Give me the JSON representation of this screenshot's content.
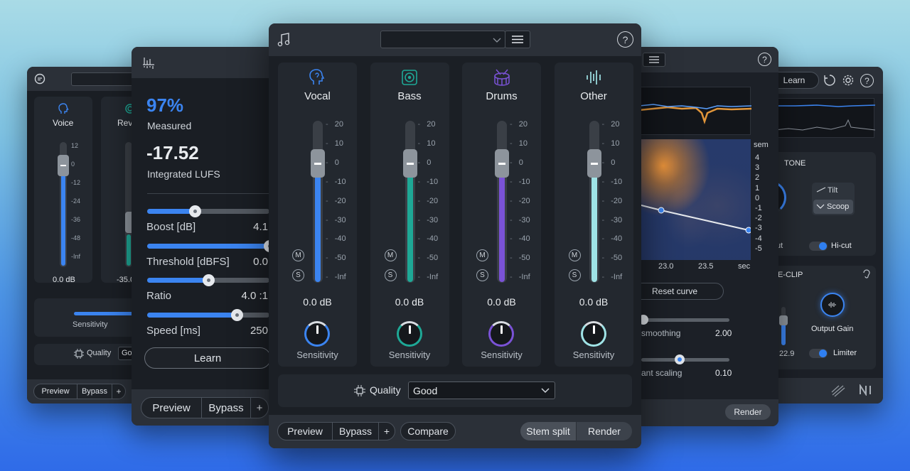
{
  "far_left": {
    "channels": [
      {
        "label": "Voice"
      },
      {
        "label": "Rev"
      }
    ],
    "scale": [
      "12",
      "0",
      "-12",
      "-24",
      "-36",
      "-48",
      "-Inf"
    ],
    "readouts": [
      "0.0 dB",
      "-35.0"
    ],
    "sensitivity_label": "Sensitivity",
    "quality_label": "Quality",
    "quality_value": "Go",
    "preview": "Preview",
    "bypass": "Bypass",
    "plus": "+"
  },
  "loudness": {
    "percent": "97%",
    "measured": "Measured",
    "lufs": "-17.52",
    "lufs_label": "Integrated LUFS",
    "sliders": [
      {
        "label": "Boost [dB]",
        "value": "4.1",
        "level": 0.39
      },
      {
        "label": "Threshold [dBFS]",
        "value": "0.0",
        "level": 1.0
      },
      {
        "label": "Ratio",
        "value": "4.0 :1",
        "level": 0.5
      },
      {
        "label": "Speed [ms]",
        "value": "250",
        "level": 0.73
      }
    ],
    "learn": "Learn",
    "preview": "Preview",
    "bypass": "Bypass",
    "plus": "+"
  },
  "stems": {
    "channels": [
      {
        "label": "Vocal",
        "color": "#3b84f0",
        "readout": "0.0 dB",
        "knob": "Sensitivity"
      },
      {
        "label": "Bass",
        "color": "#1ea896",
        "readout": "0.0 dB",
        "knob": "Sensitivity"
      },
      {
        "label": "Drums",
        "color": "#7a52d6",
        "readout": "0.0 dB",
        "knob": "Sensitivity"
      },
      {
        "label": "Other",
        "color": "#9fe3e6",
        "readout": "0.0 dB",
        "knob": "Sensitivity"
      }
    ],
    "scale": [
      "20",
      "10",
      "0",
      "-10",
      "-20",
      "-30",
      "-40",
      "-50",
      "-Inf"
    ],
    "mute": "M",
    "solo": "S",
    "quality_label": "Quality",
    "quality_value": "Good",
    "preview": "Preview",
    "bypass": "Bypass",
    "plus": "+",
    "compare": "Compare",
    "stem_split": "Stem split",
    "render": "Render",
    "help": "?"
  },
  "pitch": {
    "sem_label": "sem",
    "sem_ticks": [
      "4",
      "3",
      "2",
      "1",
      "0",
      "-1",
      "-2",
      "-3",
      "-4",
      "-5"
    ],
    "time_ticks": [
      "23.0",
      "23.5",
      "sec"
    ],
    "reset_curve": "Reset curve",
    "sliders": [
      {
        "label": "smoothing",
        "value": "2.00",
        "level": 0.0
      },
      {
        "label": "ant scaling",
        "value": "0.10",
        "level": 0.55
      }
    ],
    "render": "Render",
    "help": "?"
  },
  "right": {
    "learn": "Learn",
    "tone_title": "TONE",
    "tilt": "Tilt",
    "scoop": "Scoop",
    "ut": "ut",
    "hicut": "Hi-cut",
    "declip_title": "DE-CLIP",
    "output_gain": "Output Gain",
    "limiter": "Limiter",
    "value_229": "22.9",
    "help": "?"
  }
}
